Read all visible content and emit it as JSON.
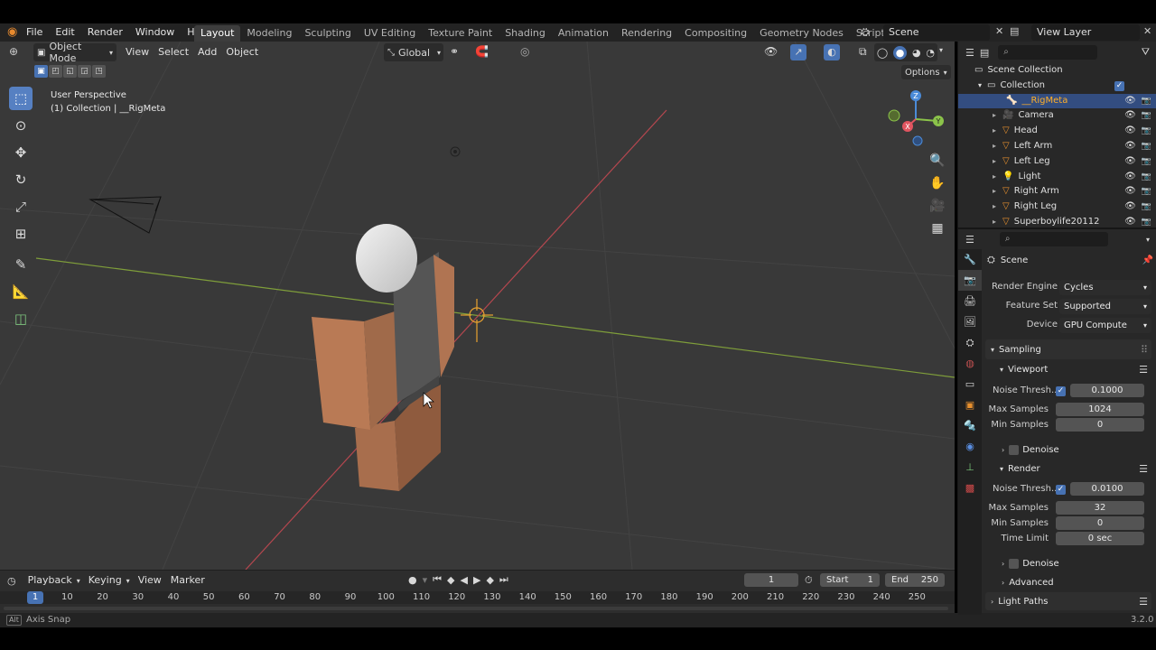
{
  "topbar": {
    "menus": [
      "File",
      "Edit",
      "Render",
      "Window",
      "Help"
    ],
    "workspaces": [
      "Layout",
      "Modeling",
      "Sculpting",
      "UV Editing",
      "Texture Paint",
      "Shading",
      "Animation",
      "Rendering",
      "Compositing",
      "Geometry Nodes",
      "Scripting"
    ],
    "active_workspace": "Layout",
    "add_tab": "+",
    "scene": "Scene",
    "view_layer": "View Layer"
  },
  "viewport": {
    "mode": "Object Mode",
    "menus": [
      "View",
      "Select",
      "Add",
      "Object"
    ],
    "orientation": "Global",
    "options": "Options",
    "overlay_title": "User Perspective",
    "overlay_subtitle": "(1) Collection | __RigMeta",
    "gizmo_axes": [
      "Z",
      "Y",
      "X"
    ]
  },
  "outliner": {
    "root": "Scene Collection",
    "collection": "Collection",
    "items": [
      {
        "name": "__RigMeta",
        "selected": true
      },
      {
        "name": "Camera",
        "selected": false
      },
      {
        "name": "Head",
        "selected": false
      },
      {
        "name": "Left Arm",
        "selected": false
      },
      {
        "name": "Left Leg",
        "selected": false
      },
      {
        "name": "Light",
        "selected": false
      },
      {
        "name": "Right Arm",
        "selected": false
      },
      {
        "name": "Right Leg",
        "selected": false
      },
      {
        "name": "Superboylife20112",
        "selected": false
      }
    ]
  },
  "properties": {
    "context": "Scene",
    "render_engine_label": "Render Engine",
    "render_engine": "Cycles",
    "feature_set_label": "Feature Set",
    "feature_set": "Supported",
    "device_label": "Device",
    "device": "GPU Compute",
    "sampling": "Sampling",
    "viewport_panel": "Viewport",
    "noise_label": "Noise Thresh...",
    "viewport_noise": "0.1000",
    "max_samples_label": "Max Samples",
    "viewport_max": "1024",
    "min_samples_label": "Min Samples",
    "viewport_min": "0",
    "denoise": "Denoise",
    "render_panel": "Render",
    "render_noise": "0.0100",
    "render_max": "32",
    "render_min": "0",
    "time_limit_label": "Time Limit",
    "time_limit": "0 sec",
    "advanced": "Advanced",
    "light_paths": "Light Paths"
  },
  "timeline": {
    "menus": [
      "Playback",
      "Keying",
      "View",
      "Marker"
    ],
    "current_frame": "1",
    "start_label": "Start",
    "start": "1",
    "end_label": "End",
    "end": "250",
    "ruler": [
      "10",
      "20",
      "30",
      "40",
      "50",
      "60",
      "70",
      "80",
      "90",
      "100",
      "110",
      "120",
      "130",
      "140",
      "150",
      "160",
      "170",
      "180",
      "190",
      "200",
      "210",
      "220",
      "230",
      "240",
      "250"
    ]
  },
  "status": {
    "key": "Alt",
    "hint": "Axis Snap",
    "version": "3.2.0"
  },
  "colors": {
    "accent": "#4772b3",
    "selected_text": "#ffaf29",
    "body_brown": "#b97a55"
  }
}
